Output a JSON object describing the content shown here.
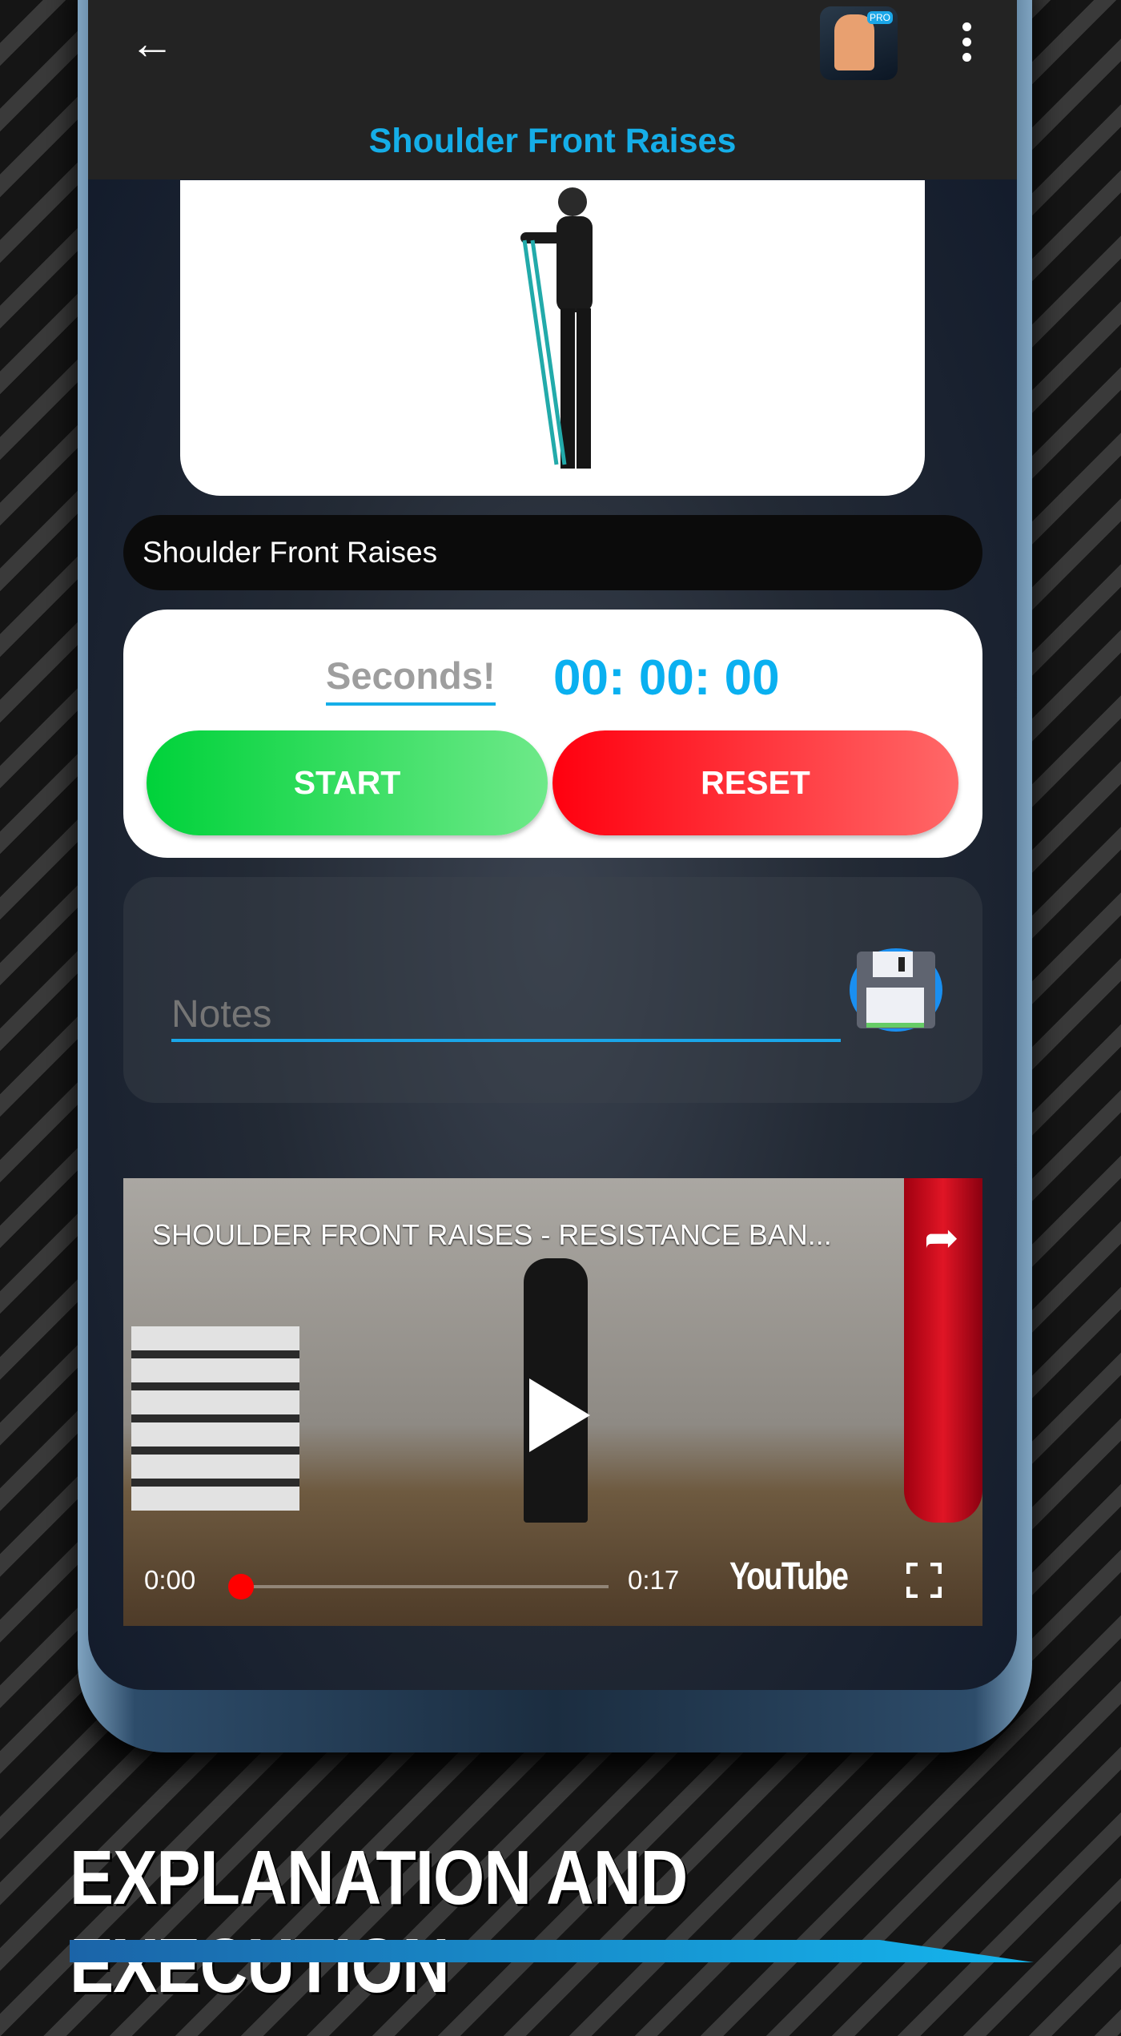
{
  "header": {
    "title": "Shoulder Front Raises",
    "back_icon": "arrow-left-icon",
    "menu_icon": "more-vertical-icon",
    "app_icon_badge": "PRO"
  },
  "exercise": {
    "name": "Shoulder Front Raises"
  },
  "timer": {
    "unit_label": "Seconds!",
    "display": "00: 00: 00",
    "start_label": "START",
    "reset_label": "RESET"
  },
  "notes": {
    "placeholder": "Notes",
    "save_icon": "floppy-disk-icon"
  },
  "video": {
    "title": "SHOULDER FRONT RAISES - RESISTANCE BAN...",
    "current_time": "0:00",
    "duration": "0:17",
    "progress": 0,
    "brand": "YouTube"
  },
  "caption": "EXPLANATION AND EXECUTION",
  "colors": {
    "accent": "#15aee8",
    "start": "#00d23a",
    "reset": "#ff000f"
  }
}
